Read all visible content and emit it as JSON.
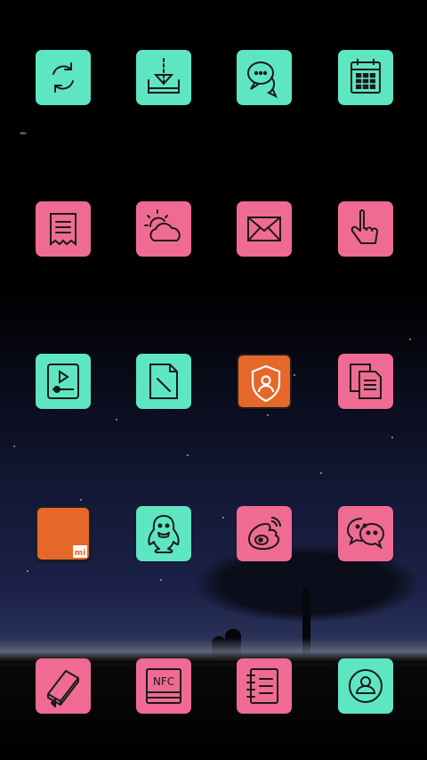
{
  "home_screen": {
    "icons": [
      {
        "id": "sync",
        "icon": "sync-icon",
        "color": "#5ee6c3"
      },
      {
        "id": "download",
        "icon": "download-icon",
        "color": "#5ee6c3"
      },
      {
        "id": "messages",
        "icon": "chat-bubbles-icon",
        "color": "#5ee6c3"
      },
      {
        "id": "calendar",
        "icon": "calendar-icon",
        "color": "#5ee6c3"
      },
      {
        "id": "receipt",
        "icon": "receipt-icon",
        "color": "#f06b94"
      },
      {
        "id": "weather",
        "icon": "weather-icon",
        "color": "#f06b94"
      },
      {
        "id": "mail",
        "icon": "mail-icon",
        "color": "#f06b94"
      },
      {
        "id": "gesture",
        "icon": "pointer-hand-icon",
        "color": "#f06b94"
      },
      {
        "id": "video",
        "icon": "video-player-icon",
        "color": "#5ee6c3"
      },
      {
        "id": "notes",
        "icon": "note-pen-icon",
        "color": "#5ee6c3"
      },
      {
        "id": "security",
        "icon": "security-shield-icon",
        "color": "#e5682a"
      },
      {
        "id": "documents",
        "icon": "documents-icon",
        "color": "#f06b94"
      },
      {
        "id": "mi-store",
        "icon": "mi-logo-icon",
        "color": "#e5682a"
      },
      {
        "id": "qq",
        "icon": "penguin-icon",
        "color": "#5ee6c3"
      },
      {
        "id": "weibo",
        "icon": "weibo-icon",
        "color": "#f06b94"
      },
      {
        "id": "wechat",
        "icon": "wechat-icon",
        "color": "#f06b94"
      }
    ],
    "dock": [
      {
        "id": "books",
        "icon": "book-icon",
        "color": "#f06b94"
      },
      {
        "id": "nfc",
        "icon": "nfc-icon",
        "label": "NFC",
        "color": "#f06b94"
      },
      {
        "id": "notebook",
        "icon": "notebook-icon",
        "color": "#f06b94"
      },
      {
        "id": "contacts",
        "icon": "contact-icon",
        "color": "#5ee6c3"
      }
    ],
    "mi_logo_text": "mi"
  }
}
